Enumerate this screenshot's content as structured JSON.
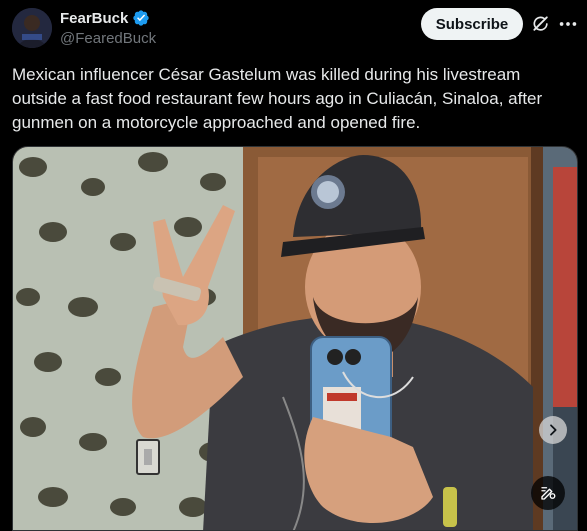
{
  "author": {
    "display_name": "FearBuck",
    "handle": "@FearedBuck",
    "verified": true,
    "avatar_icon": "avatar-icon"
  },
  "actions": {
    "subscribe_label": "Subscribe",
    "grok_icon": "grok-icon",
    "more_icon": "more-horizontal-icon"
  },
  "post": {
    "text": "Mexican influencer César Gastelum was killed during his livestream outside a fast food restaurant few hours ago in Culiacán, Sinaloa, after gunmen on a motorcycle approached and opened fire."
  },
  "media": {
    "next_icon": "chevron-right-icon",
    "alt_icon": "image-tools-icon"
  },
  "colors": {
    "background": "#000000",
    "text": "#e7e9ea",
    "secondary_text": "#71767b",
    "verified": "#1d9bf0",
    "subscribe_bg": "#eff3f4"
  }
}
